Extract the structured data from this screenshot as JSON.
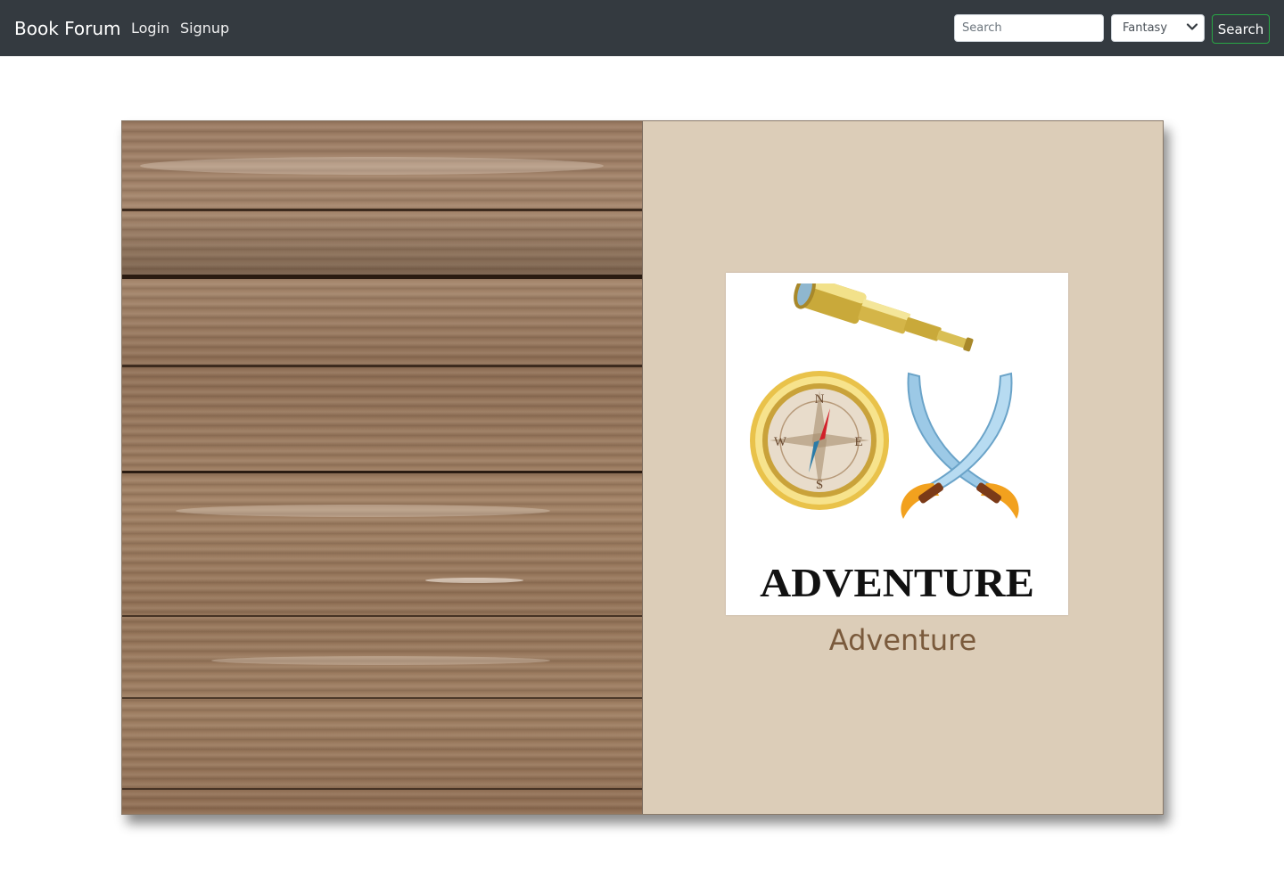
{
  "navbar": {
    "brand": "Book Forum",
    "links": [
      "Login",
      "Signup"
    ],
    "search_placeholder": "Search",
    "genre_selected": "Fantasy",
    "search_button": "Search",
    "colors": {
      "background": "#343a40",
      "button_border": "#28a745"
    }
  },
  "book": {
    "left_page": {
      "texture": "wood-planks"
    },
    "right_page": {
      "cover_image_text": "ADVENTURE",
      "cover_icons": [
        "telescope-icon",
        "compass-icon",
        "crossed-swords-icon"
      ],
      "compass_letters": [
        "N",
        "E",
        "S",
        "W"
      ],
      "genre_title": "Adventure",
      "colors": {
        "page": "#dccdb8",
        "title": "#7a5a3c"
      }
    }
  }
}
